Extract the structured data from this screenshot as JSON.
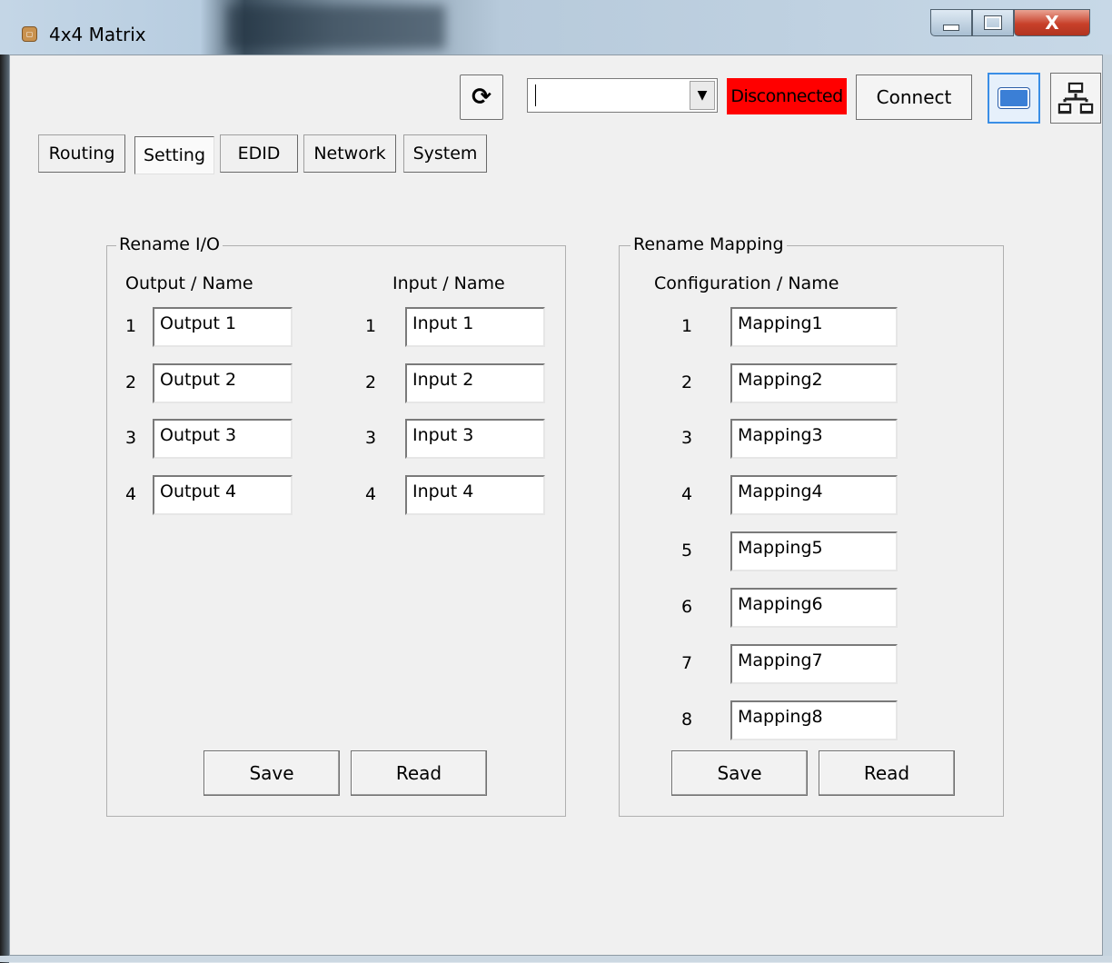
{
  "window": {
    "title": "4x4 Matrix",
    "icon": "app-icon",
    "close_label": "X"
  },
  "toolbar": {
    "refresh_icon": "⟳",
    "port_value": "",
    "status_text": "Disconnected",
    "status_color": "#ff0000",
    "connect_label": "Connect",
    "serial_icon": "serial-port-icon",
    "network_icon": "network-icon"
  },
  "tabs": [
    {
      "label": "Routing",
      "active": false
    },
    {
      "label": "Setting",
      "active": true
    },
    {
      "label": "EDID",
      "active": false
    },
    {
      "label": "Network",
      "active": false
    },
    {
      "label": "System",
      "active": false
    }
  ],
  "rename_io": {
    "legend": "Rename I/O",
    "output_header": "Output / Name",
    "input_header": "Input / Name",
    "outputs": [
      {
        "num": "1",
        "name": "Output 1"
      },
      {
        "num": "2",
        "name": "Output 2"
      },
      {
        "num": "3",
        "name": "Output 3"
      },
      {
        "num": "4",
        "name": "Output 4"
      }
    ],
    "inputs": [
      {
        "num": "1",
        "name": "Input 1"
      },
      {
        "num": "2",
        "name": "Input 2"
      },
      {
        "num": "3",
        "name": "Input 3"
      },
      {
        "num": "4",
        "name": "Input 4"
      }
    ],
    "save_label": "Save",
    "read_label": "Read"
  },
  "rename_mapping": {
    "legend": "Rename Mapping",
    "header": "Configuration / Name",
    "rows": [
      {
        "num": "1",
        "name": "Mapping1"
      },
      {
        "num": "2",
        "name": "Mapping2"
      },
      {
        "num": "3",
        "name": "Mapping3"
      },
      {
        "num": "4",
        "name": "Mapping4"
      },
      {
        "num": "5",
        "name": "Mapping5"
      },
      {
        "num": "6",
        "name": "Mapping6"
      },
      {
        "num": "7",
        "name": "Mapping7"
      },
      {
        "num": "8",
        "name": "Mapping8"
      }
    ],
    "save_label": "Save",
    "read_label": "Read"
  }
}
